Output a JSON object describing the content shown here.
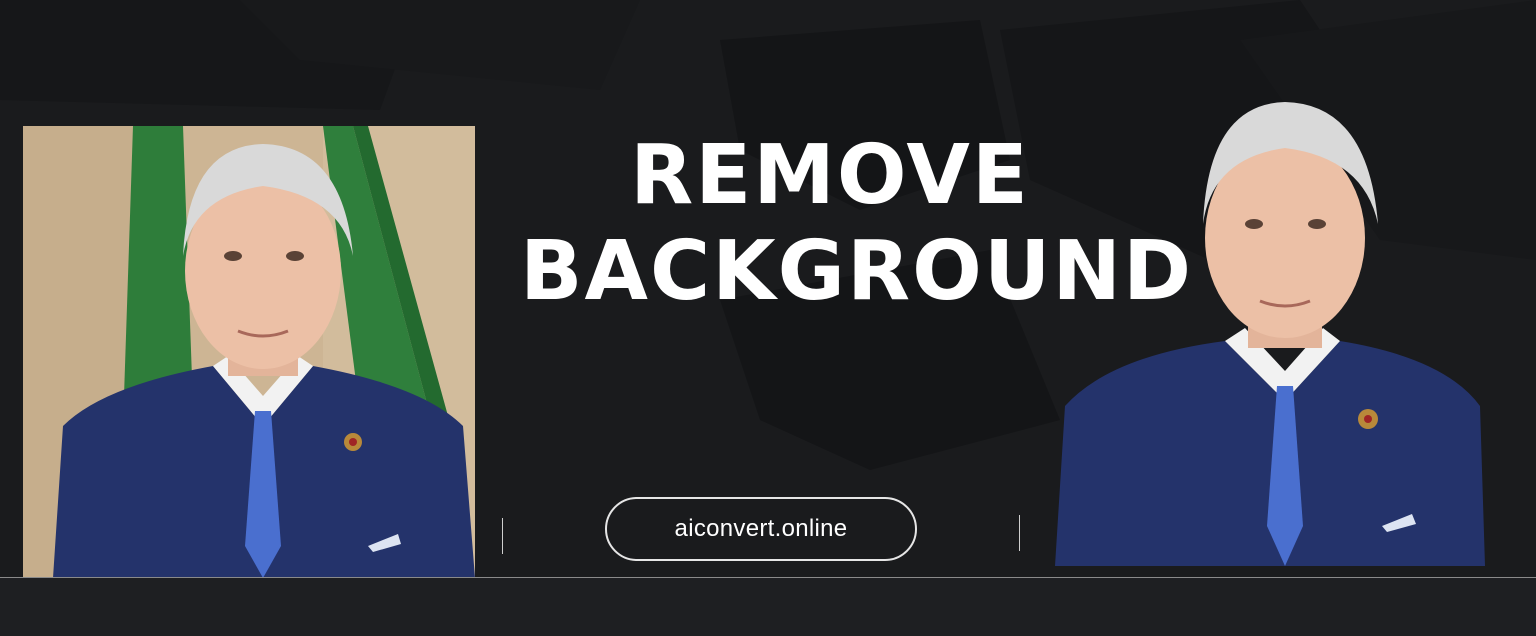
{
  "headline": {
    "line1": "REMOVE",
    "line2": "BACKGROUND"
  },
  "badge": {
    "text": "aiconvert.online"
  },
  "photos": {
    "before": "portrait-with-background",
    "after": "portrait-background-removed"
  },
  "colors": {
    "background": "#1a1b1d",
    "shape": "#141416",
    "text": "#ffffff",
    "suit": "#24336b",
    "tie": "#4a6fcf",
    "flag": "#2e7d3a",
    "wall": "#cdb594"
  }
}
